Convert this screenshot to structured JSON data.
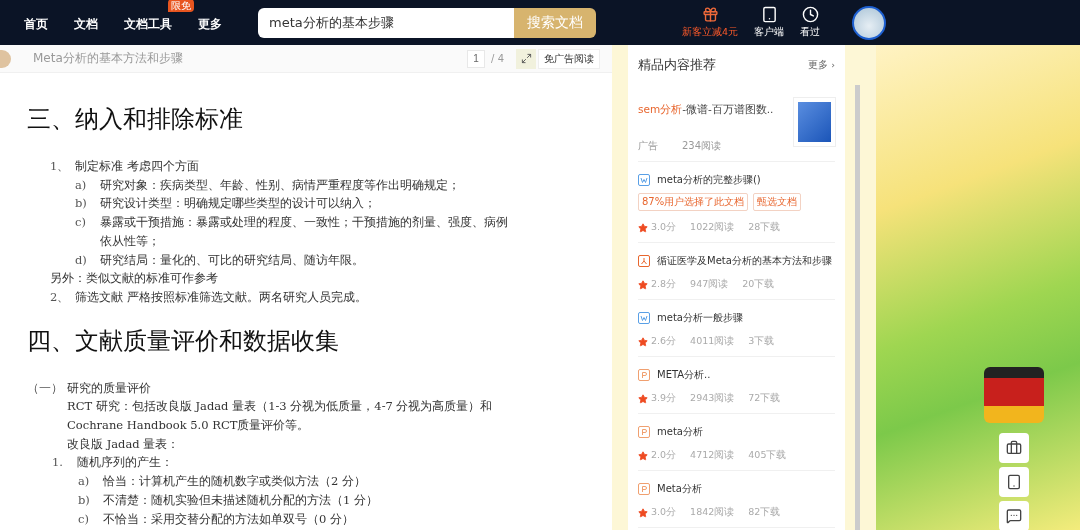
{
  "header": {
    "nav": [
      {
        "label": "首页"
      },
      {
        "label": "文档"
      },
      {
        "label": "文档工具",
        "badge": "限免"
      },
      {
        "label": "更多"
      }
    ],
    "search": {
      "value": "meta分析的基本步骤",
      "button": "搜索文档"
    },
    "actions": [
      {
        "kind": "gift",
        "label": "新客立减4元"
      },
      {
        "kind": "device",
        "label": "客户端"
      },
      {
        "kind": "history",
        "label": "看过"
      }
    ]
  },
  "toolbar": {
    "title": "Meta分析的基本方法和步骤",
    "page": "1",
    "pages": "/ 4",
    "ad_free": "免广告阅读"
  },
  "document": [
    {
      "kind": "heading",
      "text": "三、纳入和排除标准"
    },
    {
      "kind": "item",
      "marker": "1、",
      "text": "制定标准 考虑四个方面",
      "children": [
        {
          "kind": "item",
          "marker": "a)",
          "text": "研究对象：疾病类型、年龄、性别、病情严重程度等作出明确规定；"
        },
        {
          "kind": "item",
          "marker": "b)",
          "text": "研究设计类型：明确规定哪些类型的设计可以纳入；"
        },
        {
          "kind": "item",
          "marker": "c)",
          "text": "暴露或干预措施：暴露或处理的程度、一致性；干预措施的剂量、强度、病例依从性等；"
        },
        {
          "kind": "item",
          "marker": "d)",
          "text": "研究结局：量化的、可比的研究结局、随访年限。"
        }
      ]
    },
    {
      "kind": "note",
      "text": "另外：类似文献的标准可作参考"
    },
    {
      "kind": "item",
      "marker": "2、",
      "text": "筛选文献 严格按照标准筛选文献。两名研究人员完成。"
    },
    {
      "kind": "heading",
      "text": "四、文献质量评价和数据收集"
    },
    {
      "kind": "item",
      "marker": "（一）",
      "text": "研究的质量评价",
      "children": [
        {
          "kind": "note",
          "text": "RCT 研究：包括改良版 Jadad 量表（1-3 分视为低质量，4-7 分视为高质量）和 Cochrane Handbook  5.0  RCT质量评价等。"
        },
        {
          "kind": "note",
          "text": "改良版 Jadad 量表："
        },
        {
          "kind": "item",
          "marker": "1.",
          "text": "随机序列的产生：",
          "children": [
            {
              "kind": "item",
              "marker": "a)",
              "text": "恰当：计算机产生的随机数字或类似方法（2 分）"
            },
            {
              "kind": "item",
              "marker": "b)",
              "text": "不清楚：随机实验但未描述随机分配的方法（1 分）"
            },
            {
              "kind": "item",
              "marker": "c)",
              "text": "不恰当：采用交替分配的方法如单双号（0 分）"
            }
          ]
        }
      ]
    }
  ],
  "recommend": {
    "title": "精品内容推荐",
    "more": "更多 ›",
    "ad": {
      "highlight": "sem分析",
      "title": "-微谱-百万谱图数..",
      "label": "广告",
      "reads": "234阅读"
    },
    "docs": [
      {
        "kind": "word",
        "title": "meta分析的完整步骤()",
        "tags": [
          "87%用户选择了此文档",
          "甄选文档"
        ],
        "score": "3.0分",
        "reads": "1022阅读",
        "downloads": "28下载"
      },
      {
        "kind": "pdf",
        "title": "循证医学及Meta分析的基本方法和步骤",
        "score": "2.8分",
        "reads": "947阅读",
        "downloads": "20下载"
      },
      {
        "kind": "word",
        "title": "meta分析一般步骤",
        "score": "2.6分",
        "reads": "4011阅读",
        "downloads": "3下载"
      },
      {
        "kind": "ppt",
        "title": "META分析..",
        "score": "3.9分",
        "reads": "2943阅读",
        "downloads": "72下载"
      },
      {
        "kind": "ppt",
        "title": "meta分析",
        "score": "2.0分",
        "reads": "4712阅读",
        "downloads": "405下载"
      },
      {
        "kind": "ppt",
        "title": "Meta分析",
        "score": "3.0分",
        "reads": "1842阅读",
        "downloads": "82下载"
      }
    ]
  }
}
